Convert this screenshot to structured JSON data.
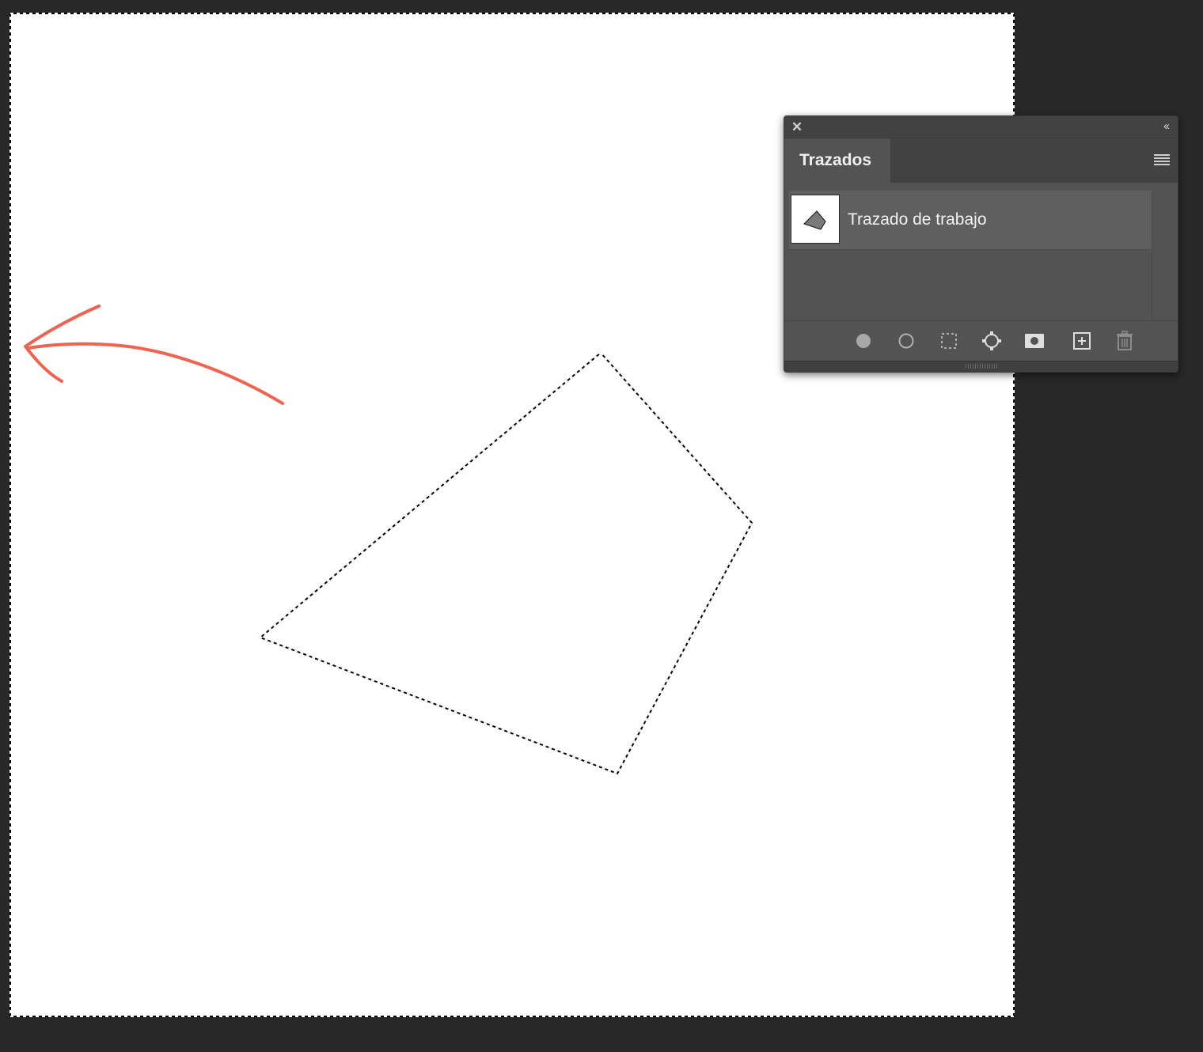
{
  "panel": {
    "tab_label": "Trazados",
    "close_icon": "close-icon",
    "collapse_icon": "double-chevron-left-icon",
    "menu_icon": "panel-menu-icon",
    "paths": [
      {
        "label": "Trazado de trabajo",
        "thumbnail": "path-thumbnail-quadrilateral"
      }
    ],
    "footer_icons": [
      "fill-path-icon",
      "stroke-path-icon",
      "load-path-as-selection-icon",
      "make-work-path-icon",
      "add-mask-icon",
      "new-path-icon",
      "delete-path-icon"
    ]
  },
  "canvas": {
    "background": "#ffffff",
    "selection": "marching-ants-quadrilateral",
    "annotation_arrow_color": "#ef6351"
  },
  "colors": {
    "workspace_bg": "#282828",
    "panel_bg": "#535353",
    "panel_header_bg": "#424242"
  }
}
